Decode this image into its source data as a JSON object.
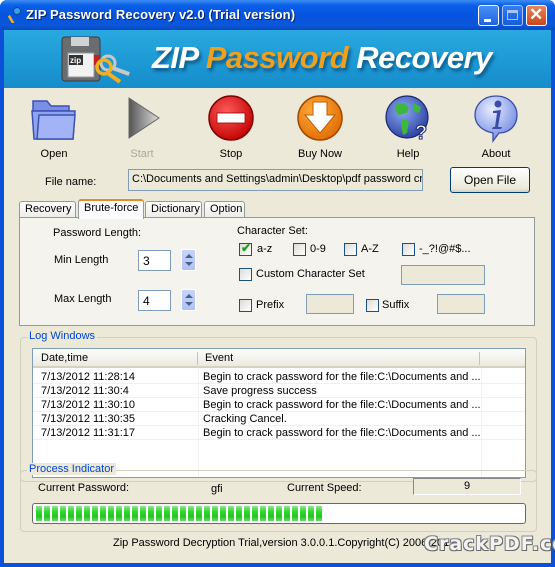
{
  "window": {
    "title": "ZIP Password Recovery v2.0 (Trial version)",
    "controls": [
      "minimize",
      "maximize",
      "close"
    ]
  },
  "banner": {
    "title_part1": "ZIP ",
    "title_part2": "Password",
    "title_part3": " Recovery",
    "logo_icon": "zip-disk-keys-icon",
    "logo_text": "zip",
    "accent_color": "#f0a01a"
  },
  "toolbar": {
    "buttons": [
      {
        "label": "Open",
        "icon": "folder-icon",
        "enabled": true
      },
      {
        "label": "Start",
        "icon": "play-icon",
        "enabled": false
      },
      {
        "label": "Stop",
        "icon": "stop-icon",
        "enabled": true
      },
      {
        "label": "Buy Now",
        "icon": "download-arrow-icon",
        "enabled": true
      },
      {
        "label": "Help",
        "icon": "globe-help-icon",
        "enabled": true
      },
      {
        "label": "About",
        "icon": "info-icon",
        "enabled": true
      }
    ]
  },
  "file": {
    "label": "File name:",
    "value": "C:\\Documents and Settings\\admin\\Desktop\\pdf password cr",
    "open_button": "Open File"
  },
  "tabs": {
    "items": [
      "Recovery",
      "Brute-force",
      "Dictionary",
      "Option"
    ],
    "active": "Brute-force"
  },
  "brute_force": {
    "password_length_label": "Password Length:",
    "min_label": "Min Length",
    "min_value": "3",
    "max_label": "Max Length",
    "max_value": "4",
    "charset_label": "Character Set:",
    "charsets": [
      {
        "label": "a-z",
        "checked": true
      },
      {
        "label": "0-9",
        "checked": false
      },
      {
        "label": "A-Z",
        "checked": false
      },
      {
        "label": "-_?!@#$...",
        "checked": false
      }
    ],
    "custom": {
      "label": "Custom Character Set",
      "checked": false,
      "value": ""
    },
    "prefix": {
      "label": "Prefix",
      "checked": false,
      "value": ""
    },
    "suffix": {
      "label": "Suffix",
      "checked": false,
      "value": ""
    }
  },
  "log": {
    "title": "Log Windows",
    "columns": [
      "Date,time",
      "Event"
    ],
    "rows": [
      {
        "datetime": "7/13/2012 11:28:14",
        "event": "Begin to crack password for the file:C:\\Documents and ..."
      },
      {
        "datetime": "7/13/2012 11:30:4",
        "event": "Save progress success"
      },
      {
        "datetime": "7/13/2012 11:30:10",
        "event": "Begin to crack password for the file:C:\\Documents and ..."
      },
      {
        "datetime": "7/13/2012 11:30:35",
        "event": "Cracking Cancel."
      },
      {
        "datetime": "7/13/2012 11:31:17",
        "event": "Begin to crack password for the file:C:\\Documents and ..."
      }
    ]
  },
  "process": {
    "title": "Process Indicator",
    "current_password_label": "Current Password:",
    "current_password": "gfi",
    "current_speed_label": "Current Speed:",
    "current_speed": "9",
    "progress_percent": 59,
    "progress_color": "#2fd52f"
  },
  "footer": {
    "copyright": "Zip Password Decryption Trial,version 3.0.0.1.Copyright(C) 2006-2012",
    "watermark": "CrackPDF.com"
  }
}
